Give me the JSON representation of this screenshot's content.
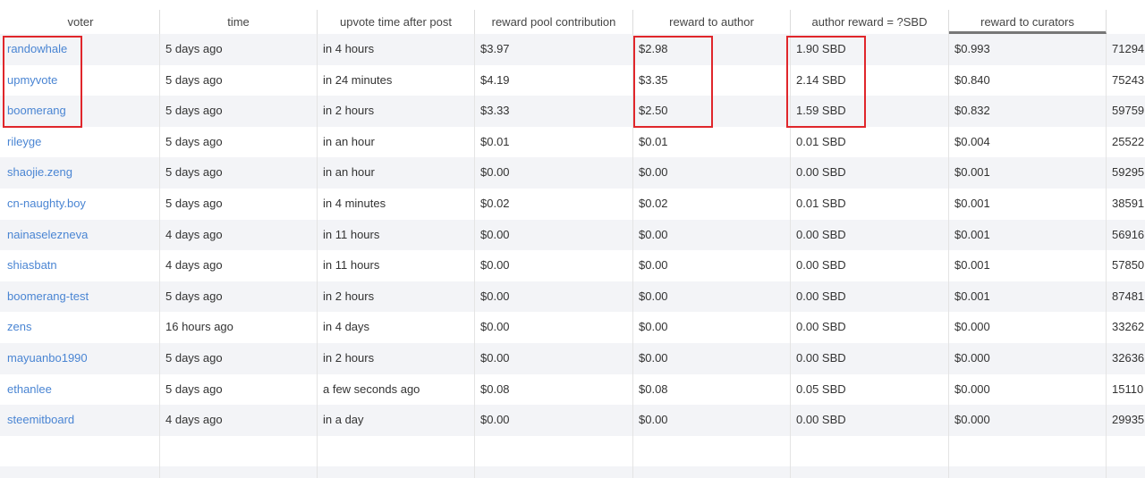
{
  "table": {
    "headers": [
      "voter",
      "time",
      "upvote time after post",
      "reward pool contribution",
      "reward to author",
      "author reward = ?SBD",
      "reward to curators",
      ""
    ],
    "rows": [
      [
        "randowhale",
        "5 days ago",
        "in 4 hours",
        "$3.97",
        "$2.98",
        "1.90 SBD",
        "$0.993",
        "71294"
      ],
      [
        "upmyvote",
        "5 days ago",
        "in 24 minutes",
        "$4.19",
        "$3.35",
        "2.14 SBD",
        "$0.840",
        "75243"
      ],
      [
        "boomerang",
        "5 days ago",
        "in 2 hours",
        "$3.33",
        "$2.50",
        "1.59 SBD",
        "$0.832",
        "59759"
      ],
      [
        "rileyge",
        "5 days ago",
        "in an hour",
        "$0.01",
        "$0.01",
        "0.01 SBD",
        "$0.004",
        "25522"
      ],
      [
        "shaojie.zeng",
        "5 days ago",
        "in an hour",
        "$0.00",
        "$0.00",
        "0.00 SBD",
        "$0.001",
        "59295"
      ],
      [
        "cn-naughty.boy",
        "5 days ago",
        "in 4 minutes",
        "$0.02",
        "$0.02",
        "0.01 SBD",
        "$0.001",
        "38591"
      ],
      [
        "nainaselezneva",
        "4 days ago",
        "in 11 hours",
        "$0.00",
        "$0.00",
        "0.00 SBD",
        "$0.001",
        "56916"
      ],
      [
        "shiasbatn",
        "4 days ago",
        "in 11 hours",
        "$0.00",
        "$0.00",
        "0.00 SBD",
        "$0.001",
        "57850"
      ],
      [
        "boomerang-test",
        "5 days ago",
        "in 2 hours",
        "$0.00",
        "$0.00",
        "0.00 SBD",
        "$0.001",
        "87481"
      ],
      [
        "zens",
        "16 hours ago",
        "in 4 days",
        "$0.00",
        "$0.00",
        "0.00 SBD",
        "$0.000",
        "33262"
      ],
      [
        "mayuanbo1990",
        "5 days ago",
        "in 2 hours",
        "$0.00",
        "$0.00",
        "0.00 SBD",
        "$0.000",
        "32636"
      ],
      [
        "ethanlee",
        "5 days ago",
        "a few seconds ago",
        "$0.08",
        "$0.08",
        "0.05 SBD",
        "$0.000",
        "15110"
      ],
      [
        "steemitboard",
        "4 days ago",
        "in a day",
        "$0.00",
        "$0.00",
        "0.00 SBD",
        "$0.000",
        "29935"
      ],
      [
        "",
        "",
        "",
        "",
        "",
        "",
        "",
        ""
      ],
      [
        "",
        "",
        "",
        "",
        "",
        "",
        "",
        ""
      ]
    ]
  },
  "colors": {
    "link": "#4a85d3",
    "highlight_box": "#e0262b",
    "row_alt": "#f3f4f7"
  }
}
